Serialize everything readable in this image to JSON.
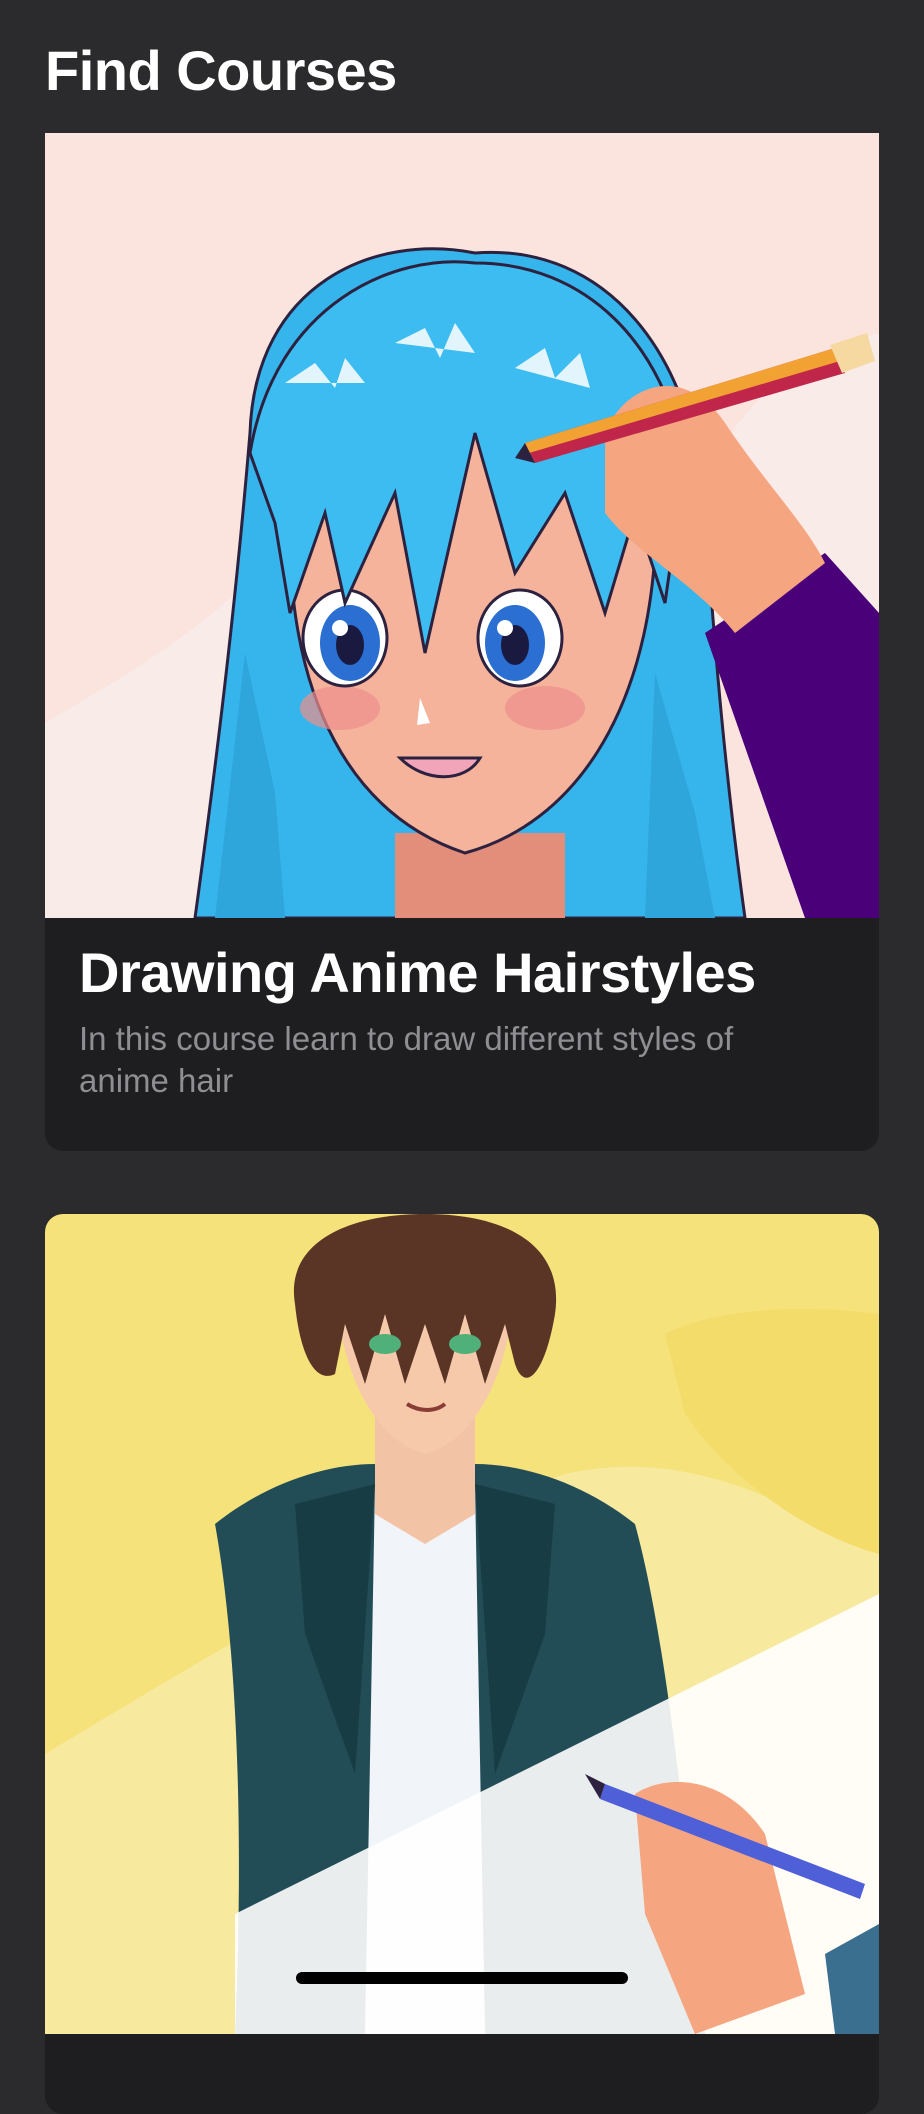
{
  "header": {
    "title": "Find Courses"
  },
  "courses": [
    {
      "title": "Drawing Anime Hairstyles",
      "description": "In this course learn to draw different styles of anime hair",
      "image_icon": "anime-girl-illustration",
      "image_bg": "#fbe3de"
    },
    {
      "title": "",
      "description": "",
      "image_icon": "anime-boy-illustration",
      "image_bg": "#f6e27a"
    }
  ],
  "colors": {
    "background": "#2b2b2d",
    "card": "#1e1e20",
    "title_text": "#ffffff",
    "secondary_text": "#8e8e93"
  }
}
